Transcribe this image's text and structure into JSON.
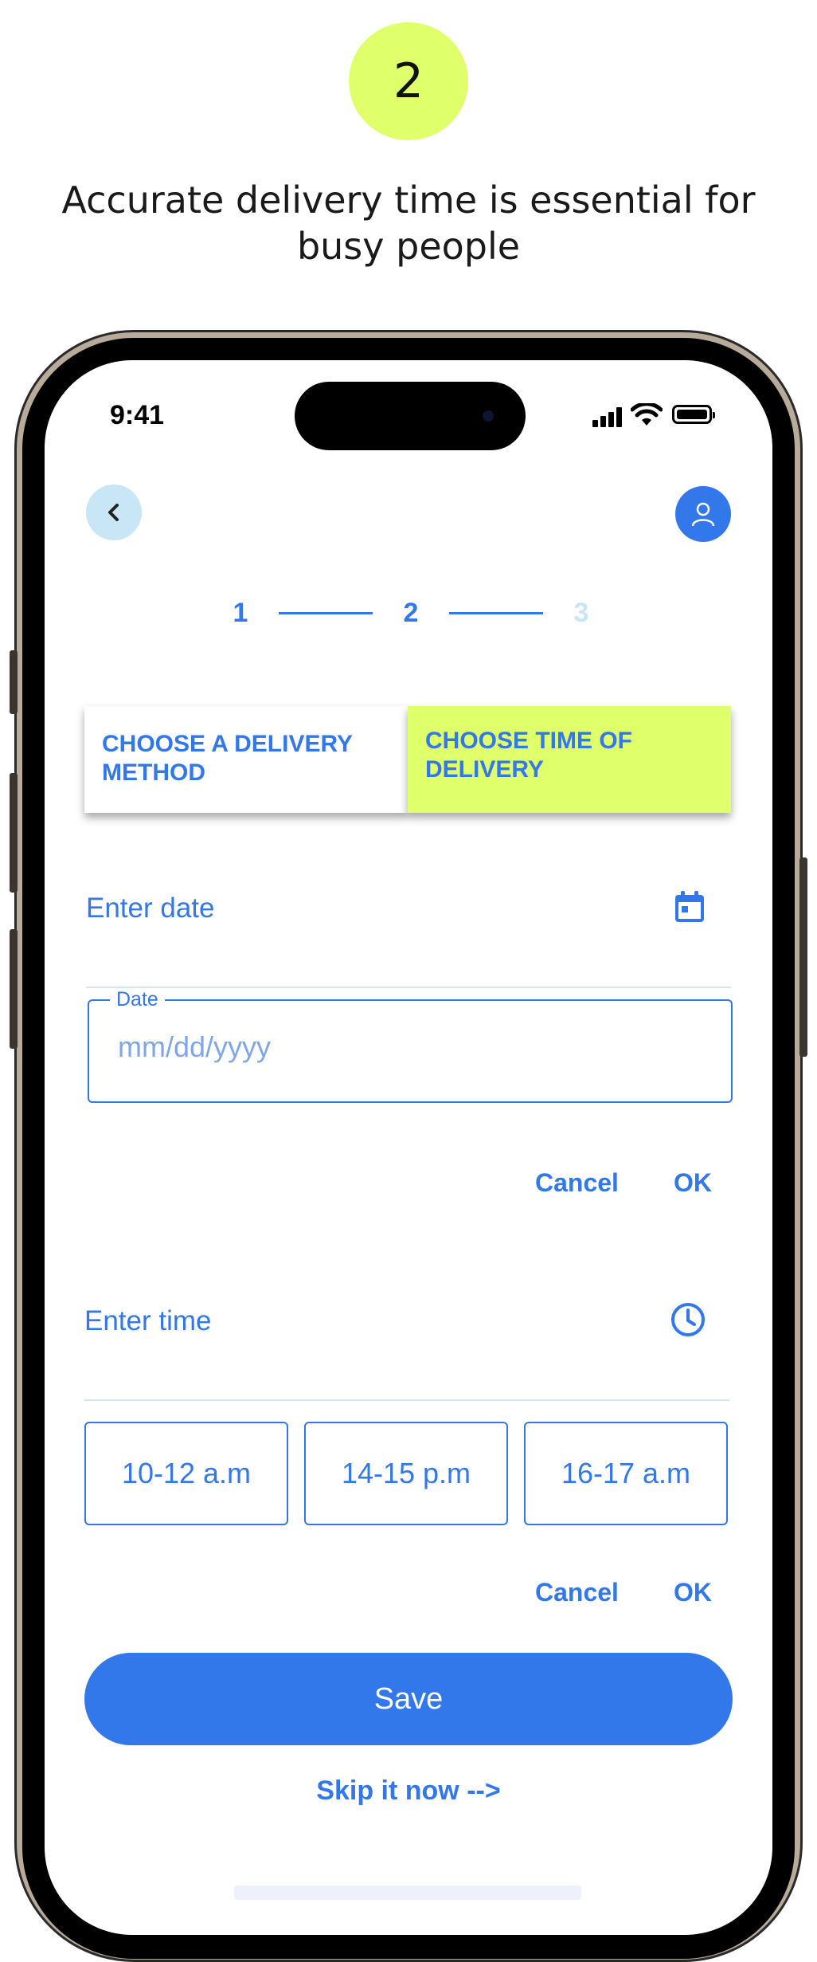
{
  "header": {
    "step_badge": "2",
    "headline": "Accurate delivery time is essential for busy people"
  },
  "status_bar": {
    "time": "9:41"
  },
  "nav": {
    "back_icon": "chevron-left-icon",
    "user_icon": "user-icon"
  },
  "stepper": {
    "steps": [
      "1",
      "2",
      "3"
    ],
    "current": 2
  },
  "tabs": [
    {
      "label": "CHOOSE A DELIVERY METHOD",
      "active": false
    },
    {
      "label": "CHOOSE TIME OF DELIVERY",
      "active": true
    }
  ],
  "date_section": {
    "label": "Enter date",
    "icon": "calendar-icon",
    "field_legend": "Date",
    "placeholder": "mm/dd/yyyy",
    "value": "",
    "cancel": "Cancel",
    "ok": "OK"
  },
  "time_section": {
    "label": "Enter time",
    "icon": "clock-icon",
    "slots": [
      "10-12 a.m",
      "14-15 p.m",
      "16-17 a.m"
    ],
    "cancel": "Cancel",
    "ok": "OK"
  },
  "actions": {
    "save": "Save",
    "skip": "Skip it now -->"
  },
  "colors": {
    "accent": "#3378ea",
    "highlight": "#dfff6b",
    "light_blue": "#c9e6f7"
  }
}
